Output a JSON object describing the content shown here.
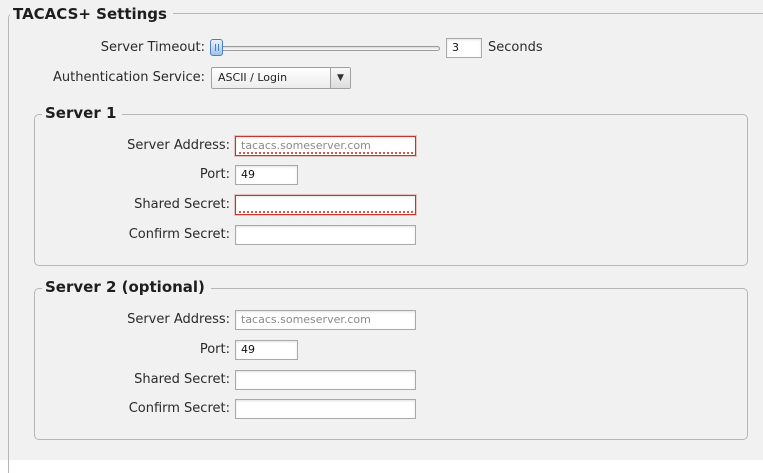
{
  "tacacs": {
    "title": "TACACS+ Settings",
    "timeout": {
      "label": "Server Timeout:",
      "value": "3",
      "unit": "Seconds",
      "slider_fraction": 0.0
    },
    "auth": {
      "label": "Authentication Service:",
      "selected": "ASCII / Login",
      "arrow_icon": "chevron-down-icon"
    }
  },
  "server1": {
    "title": "Server 1",
    "address_label": "Server Address:",
    "address_placeholder": "tacacs.someserver.com",
    "port_label": "Port:",
    "port_value": "49",
    "secret_label": "Shared Secret:",
    "secret_value": "",
    "confirm_label": "Confirm Secret:",
    "confirm_value": ""
  },
  "server2": {
    "title": "Server 2 (optional)",
    "address_label": "Server Address:",
    "address_placeholder": "tacacs.someserver.com",
    "port_label": "Port:",
    "port_value": "49",
    "secret_label": "Shared Secret:",
    "secret_value": "",
    "confirm_label": "Confirm Secret:",
    "confirm_value": ""
  },
  "colors": {
    "panel_bg": "#f1f1f1",
    "invalid_border": "#c0392b",
    "slider_accent": "#4a7fc1"
  }
}
